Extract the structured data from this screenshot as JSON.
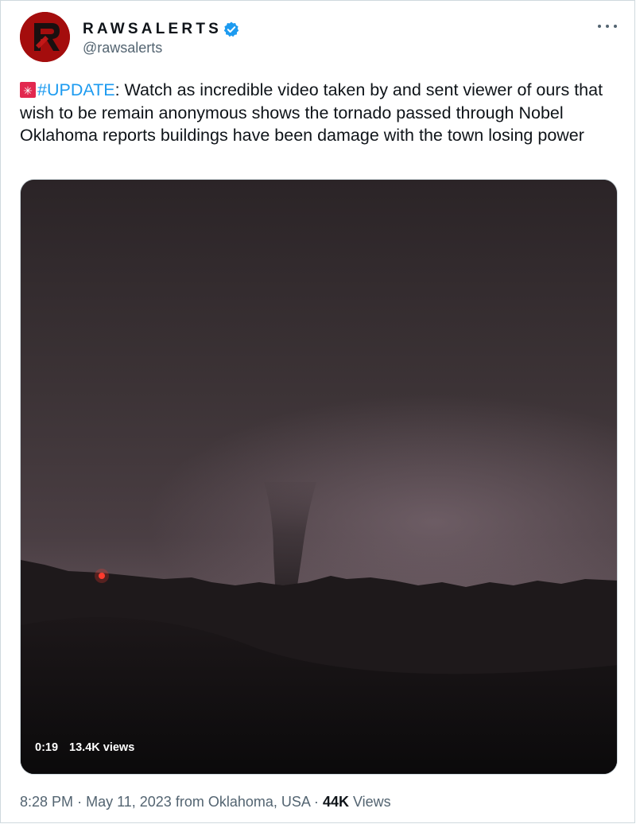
{
  "account": {
    "display_name": "RAWSALERTS",
    "handle": "@rawsalerts",
    "avatar_letter": "R",
    "brand_color": "#a40d0d",
    "verified_color": "#1d9bf0"
  },
  "tweet": {
    "hashtag": "#UPDATE",
    "text": ": Watch as incredible video taken by and sent viewer of ours that wish to be remain anonymous shows the tornado passed through Nobel Oklahoma reports buildings have been damage with the town losing power",
    "icons": [
      "siren-icon",
      "verified-badge-icon",
      "more-options-icon"
    ]
  },
  "video": {
    "duration": "0:19",
    "views": "13.4K views"
  },
  "meta": {
    "time": "8:28 PM",
    "date": "May 11, 2023",
    "location": "from Oklahoma, USA",
    "views_count": "44K",
    "views_label": "Views",
    "separator": "·"
  }
}
